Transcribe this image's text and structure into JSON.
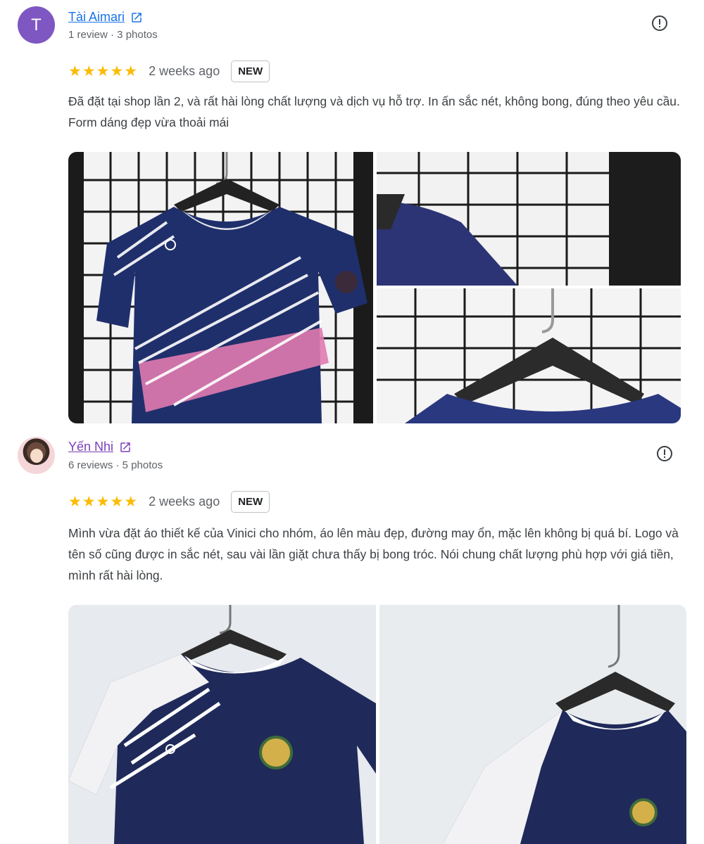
{
  "reviews": [
    {
      "avatar_letter": "T",
      "name": "Tài Aimari",
      "meta": "1 review · 3 photos",
      "stars": "★★★★★",
      "time": "2 weeks ago",
      "badge": "NEW",
      "text": "Đã đặt tại shop lần 2, và rất hài lòng chất lượng và dịch vụ hỗ trợ. In ấn sắc nét, không bong, đúng theo yêu cầu. Form dáng đẹp vừa thoải mái",
      "rating": 5
    },
    {
      "name": "Yến Nhi",
      "meta": "6 reviews · 5 photos",
      "stars": "★★★★★",
      "time": "2 weeks ago",
      "badge": "NEW",
      "text": "Mình vừa đặt áo thiết kế của Vinici cho nhóm, áo lên màu đẹp, đường may ổn, mặc lên không bị quá bí. Logo và tên số cũng được in sắc nét, sau vài lần giặt chưa thấy bị bong tróc. Nói chung chất lượng phù hợp với giá tiền, mình rất hài lòng.",
      "rating": 5
    }
  ],
  "colors": {
    "star": "#fbbc04",
    "link": "#1a73e8",
    "link_visited": "#7b3fb8",
    "avatar": "#7e57c2",
    "jersey_navy": "#1f2f6b",
    "jersey_pink": "#e07bb0"
  },
  "icons": [
    "external-link-icon",
    "report-flag-icon",
    "star-icon"
  ]
}
